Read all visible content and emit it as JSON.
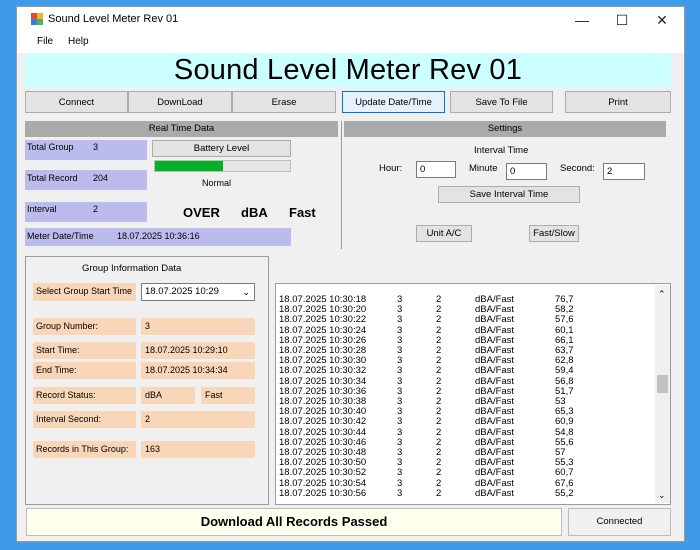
{
  "window": {
    "title": "Sound Level Meter Rev 01",
    "controls": {
      "minimize": "—",
      "maximize": "☐",
      "close": "✕"
    }
  },
  "menu": [
    "File",
    "Help"
  ],
  "banner": "Sound Level Meter Rev 01",
  "toolbar": [
    "Connect",
    "DownLoad",
    "Erase",
    "Update Date/Time",
    "Save To File",
    "Print"
  ],
  "realtime": {
    "header": "Real Time Data",
    "total_group_label": "Total Group",
    "total_group_value": "3",
    "total_record_label": "Total Record",
    "total_record_value": "204",
    "interval_label": "Interval",
    "interval_value": "2",
    "meter_date_label": "Meter Date/Time",
    "meter_date_value": "18.07.2025 10:36:16",
    "battery_label": "Battery Level",
    "battery_fraction": 0.5,
    "battery_status": "Normal",
    "over": "OVER",
    "unit": "dBA",
    "speed": "Fast"
  },
  "settings": {
    "header": "Settings",
    "interval_title": "Interval Time",
    "hour_label": "Hour:",
    "hour_value": "0",
    "minute_label": "Minute",
    "minute_value": "0",
    "second_label": "Second:",
    "second_value": "2",
    "save_button": "Save Interval Time",
    "unit_button": "Unit A/C",
    "fastslow_button": "Fast/Slow"
  },
  "group": {
    "title": "Group Information Data",
    "select_label": "Select Group Start Time",
    "select_value": "18.07.2025 10:29",
    "number_label": "Group Number:",
    "number_value": "3",
    "start_label": "Start Time:",
    "start_value": "18.07.2025 10:29:10",
    "end_label": "End Time:",
    "end_value": "18.07.2025 10:34:34",
    "status_label": "Record Status:",
    "status_unit": "dBA",
    "status_speed": "Fast",
    "interval_label": "Interval Second:",
    "interval_value": "2",
    "records_label": "Records in This Group:",
    "records_value": "163"
  },
  "records": [
    [
      "18.07.2025 10:30:18",
      "3",
      "2",
      "dBA/Fast",
      "76,7"
    ],
    [
      "18.07.2025 10:30:20",
      "3",
      "2",
      "dBA/Fast",
      "58,2"
    ],
    [
      "18.07.2025 10:30:22",
      "3",
      "2",
      "dBA/Fast",
      "57,6"
    ],
    [
      "18.07.2025 10:30:24",
      "3",
      "2",
      "dBA/Fast",
      "60,1"
    ],
    [
      "18.07.2025 10:30:26",
      "3",
      "2",
      "dBA/Fast",
      "66,1"
    ],
    [
      "18.07.2025 10:30:28",
      "3",
      "2",
      "dBA/Fast",
      "63,7"
    ],
    [
      "18.07.2025 10:30:30",
      "3",
      "2",
      "dBA/Fast",
      "62,8"
    ],
    [
      "18.07.2025 10:30:32",
      "3",
      "2",
      "dBA/Fast",
      "59,4"
    ],
    [
      "18.07.2025 10:30:34",
      "3",
      "2",
      "dBA/Fast",
      "56,8"
    ],
    [
      "18.07.2025 10:30:36",
      "3",
      "2",
      "dBA/Fast",
      "51,7"
    ],
    [
      "18.07.2025 10:30:38",
      "3",
      "2",
      "dBA/Fast",
      "53"
    ],
    [
      "18.07.2025 10:30:40",
      "3",
      "2",
      "dBA/Fast",
      "65,3"
    ],
    [
      "18.07.2025 10:30:42",
      "3",
      "2",
      "dBA/Fast",
      "60,9"
    ],
    [
      "18.07.2025 10:30:44",
      "3",
      "2",
      "dBA/Fast",
      "54,8"
    ],
    [
      "18.07.2025 10:30:46",
      "3",
      "2",
      "dBA/Fast",
      "55,6"
    ],
    [
      "18.07.2025 10:30:48",
      "3",
      "2",
      "dBA/Fast",
      "57"
    ],
    [
      "18.07.2025 10:30:50",
      "3",
      "2",
      "dBA/Fast",
      "55,3"
    ],
    [
      "18.07.2025 10:30:52",
      "3",
      "2",
      "dBA/Fast",
      "60,7"
    ],
    [
      "18.07.2025 10:30:54",
      "3",
      "2",
      "dBA/Fast",
      "67,6"
    ],
    [
      "18.07.2025 10:30:56",
      "3",
      "2",
      "dBA/Fast",
      "55,2"
    ]
  ],
  "status": {
    "message": "Download All Records Passed",
    "connection": "Connected"
  },
  "colors": {
    "banner": "#ccffff",
    "battery": "#06b025",
    "lavender": "#bbbbee",
    "peach": "#fad6b8"
  }
}
